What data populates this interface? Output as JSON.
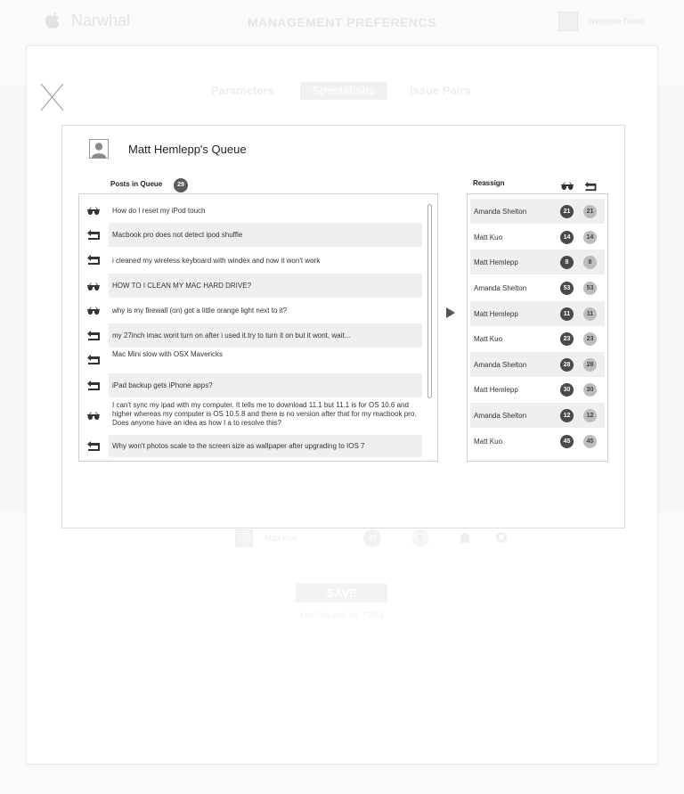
{
  "header": {
    "brand": "Narwhal",
    "title": "MANAGEMENT PREFERENCS",
    "welcome": "Welcome David"
  },
  "tabs": [
    {
      "label": "Parameters",
      "active": false
    },
    {
      "label": "Specialisits",
      "active": true
    },
    {
      "label": "Issue Pairs",
      "active": false
    }
  ],
  "queue": {
    "title": "Matt Hemlepp's Queue",
    "posts_label": "Posts in Queue",
    "posts_count": "29",
    "posts": [
      {
        "icon": "glasses-icon",
        "text": "How do I reset my iPod touch",
        "shaded": false
      },
      {
        "icon": "reply-icon",
        "text": "Macbook pro does not detect ipod shuffle",
        "shaded": true
      },
      {
        "icon": "reply-icon",
        "text": "i cleaned my wireless keyboard with windex and now it won't work",
        "shaded": false
      },
      {
        "icon": "glasses-icon",
        "text": "HOW TO I CLEAN MY MAC HARD DRIVE?",
        "shaded": true
      },
      {
        "icon": "glasses-icon",
        "text": "why is my firewall (on) got a little orange light next to it?",
        "shaded": false
      },
      {
        "icon": "reply-icon",
        "text": "my 27inch imac wont turn on after i used it.try to turn it on but it wont, wait...",
        "shaded": true
      },
      {
        "icon": "reply-icon",
        "text": "Mac Mini slow with OSX Mavericks",
        "shaded": false
      },
      {
        "icon": "reply-icon",
        "text": "iPad backup gets iPhone apps?",
        "shaded": true
      },
      {
        "icon": "glasses-icon",
        "text": "I can't sync my ipad with my computer.  It tells me to download 11.1 but 11.1 is for OS 10.6 and higher whereas my computer is OS 10.5.8 and there is no version after that for my macbook pro.  Does anyone have an idea as how I a to resolve this?",
        "shaded": false
      },
      {
        "icon": "reply-icon",
        "text": "Why won't photos scale to the screen size as wallpaper after upgrading to IOS 7",
        "shaded": true
      }
    ]
  },
  "reassign": {
    "label": "Reassign",
    "rows": [
      {
        "name": "Amanda Shelton",
        "watch": "21",
        "reply": "21",
        "shaded": true
      },
      {
        "name": "Matt Kuo",
        "watch": "14",
        "reply": "14",
        "shaded": false
      },
      {
        "name": "Matt Hemlepp",
        "watch": "8",
        "reply": "8",
        "shaded": true
      },
      {
        "name": "Amanda Shelton",
        "watch": "53",
        "reply": "53",
        "shaded": false
      },
      {
        "name": "Matt Hemlepp",
        "watch": "11",
        "reply": "11",
        "shaded": true
      },
      {
        "name": "Matt Kuo",
        "watch": "23",
        "reply": "23",
        "shaded": false
      },
      {
        "name": "Amanda Shelton",
        "watch": "28",
        "reply": "28",
        "shaded": true
      },
      {
        "name": "Matt Hemlepp",
        "watch": "30",
        "reply": "30",
        "shaded": false
      },
      {
        "name": "Amanda Shelton",
        "watch": "12",
        "reply": "12",
        "shaded": true
      },
      {
        "name": "Matt Kuo",
        "watch": "45",
        "reply": "45",
        "shaded": false
      }
    ]
  },
  "footer": {
    "specialist_name": "Matt Kuo",
    "count_a": "45",
    "count_b": "6",
    "save_label": "SAVE",
    "last_changed": "Last Changed July 7 2013"
  }
}
